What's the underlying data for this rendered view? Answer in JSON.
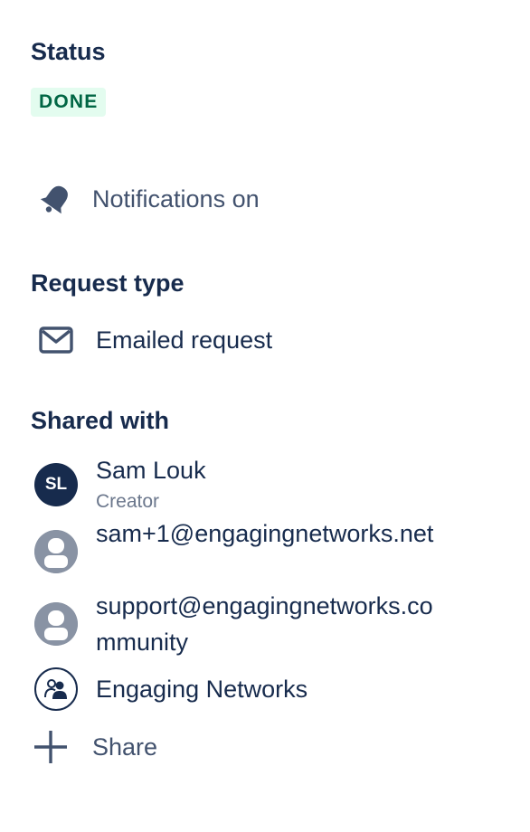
{
  "status": {
    "heading": "Status",
    "value": "DONE",
    "value_color": "#006644",
    "value_bg": "#e3fcef"
  },
  "notifications": {
    "icon": "bell-icon",
    "label": "Notifications on"
  },
  "request_type": {
    "heading": "Request type",
    "icon": "envelope-icon",
    "label": "Emailed request"
  },
  "shared_with": {
    "heading": "Shared with",
    "people": [
      {
        "initials": "SL",
        "name": "Sam Louk",
        "role": "Creator",
        "avatar": "initials"
      },
      {
        "name": "sam+1@engagingnetworks.net",
        "avatar": "default-user-icon"
      },
      {
        "name": "support@engagingnetworks.community",
        "avatar": "default-user-icon"
      },
      {
        "name": "Engaging Networks",
        "avatar": "organization-icon"
      }
    ],
    "share_icon": "plus-icon",
    "share_label": "Share"
  }
}
